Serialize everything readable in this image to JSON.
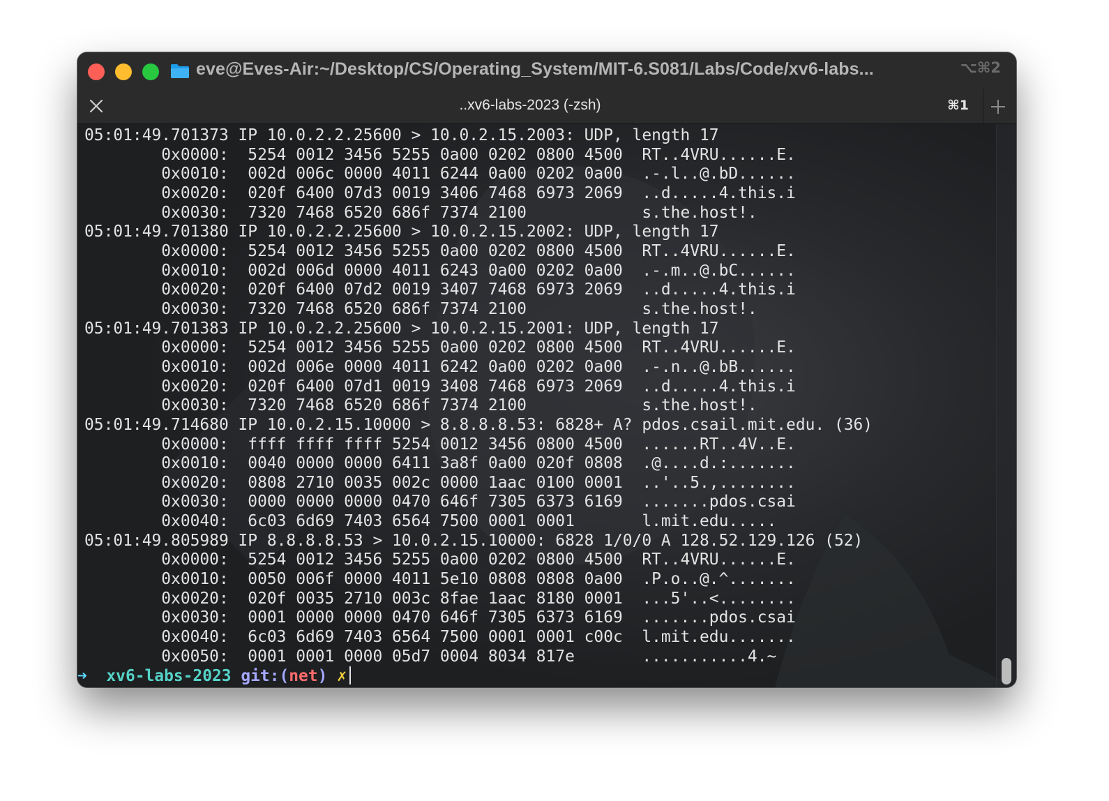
{
  "window": {
    "title": "eve@Eves-Air:~/Desktop/CS/Operating_System/MIT-6.S081/Labs/Code/xv6-labs...",
    "shortcut": "⌥⌘2"
  },
  "tab": {
    "title": "..xv6-labs-2023 (-zsh)",
    "shortcut": "⌘1"
  },
  "icons": {
    "close_tab": "close-icon",
    "new_tab": "plus-icon",
    "folder": "folder-icon"
  },
  "colors": {
    "red": "#fe5f57",
    "yellow": "#febc2e",
    "green": "#28c840",
    "folder": "#1e9be9"
  },
  "terminal": {
    "lines": [
      "05:01:49.701373 IP 10.0.2.2.25600 > 10.0.2.15.2003: UDP, length 17",
      "        0x0000:  5254 0012 3456 5255 0a00 0202 0800 4500  RT..4VRU......E.",
      "        0x0010:  002d 006c 0000 4011 6244 0a00 0202 0a00  .-.l..@.bD......",
      "        0x0020:  020f 6400 07d3 0019 3406 7468 6973 2069  ..d.....4.this.i",
      "        0x0030:  7320 7468 6520 686f 7374 2100            s.the.host!.",
      "05:01:49.701380 IP 10.0.2.2.25600 > 10.0.2.15.2002: UDP, length 17",
      "        0x0000:  5254 0012 3456 5255 0a00 0202 0800 4500  RT..4VRU......E.",
      "        0x0010:  002d 006d 0000 4011 6243 0a00 0202 0a00  .-.m..@.bC......",
      "        0x0020:  020f 6400 07d2 0019 3407 7468 6973 2069  ..d.....4.this.i",
      "        0x0030:  7320 7468 6520 686f 7374 2100            s.the.host!.",
      "05:01:49.701383 IP 10.0.2.2.25600 > 10.0.2.15.2001: UDP, length 17",
      "        0x0000:  5254 0012 3456 5255 0a00 0202 0800 4500  RT..4VRU......E.",
      "        0x0010:  002d 006e 0000 4011 6242 0a00 0202 0a00  .-.n..@.bB......",
      "        0x0020:  020f 6400 07d1 0019 3408 7468 6973 2069  ..d.....4.this.i",
      "        0x0030:  7320 7468 6520 686f 7374 2100            s.the.host!.",
      "05:01:49.714680 IP 10.0.2.15.10000 > 8.8.8.8.53: 6828+ A? pdos.csail.mit.edu. (36)",
      "        0x0000:  ffff ffff ffff 5254 0012 3456 0800 4500  ......RT..4V..E.",
      "        0x0010:  0040 0000 0000 6411 3a8f 0a00 020f 0808  .@....d.:.......",
      "        0x0020:  0808 2710 0035 002c 0000 1aac 0100 0001  ..'..5.,........",
      "        0x0030:  0000 0000 0000 0470 646f 7305 6373 6169  .......pdos.csai",
      "        0x0040:  6c03 6d69 7403 6564 7500 0001 0001       l.mit.edu.....",
      "05:01:49.805989 IP 8.8.8.8.53 > 10.0.2.15.10000: 6828 1/0/0 A 128.52.129.126 (52)",
      "        0x0000:  5254 0012 3456 5255 0a00 0202 0800 4500  RT..4VRU......E.",
      "        0x0010:  0050 006f 0000 4011 5e10 0808 0808 0a00  .P.o..@.^.......",
      "        0x0020:  020f 0035 2710 003c 8fae 1aac 8180 0001  ...5'..<........",
      "        0x0030:  0001 0000 0000 0470 646f 7305 6373 6169  .......pdos.csai",
      "        0x0040:  6c03 6d69 7403 6564 7500 0001 0001 c00c  l.mit.edu.......",
      "        0x0050:  0001 0001 0000 05d7 0004 8034 817e       ...........4.~"
    ],
    "prompt": {
      "arrow": "➜",
      "directory": "xv6-labs-2023",
      "git_label": "git:(",
      "branch": "net",
      "git_close": ")",
      "dirty_mark": "✗"
    }
  }
}
